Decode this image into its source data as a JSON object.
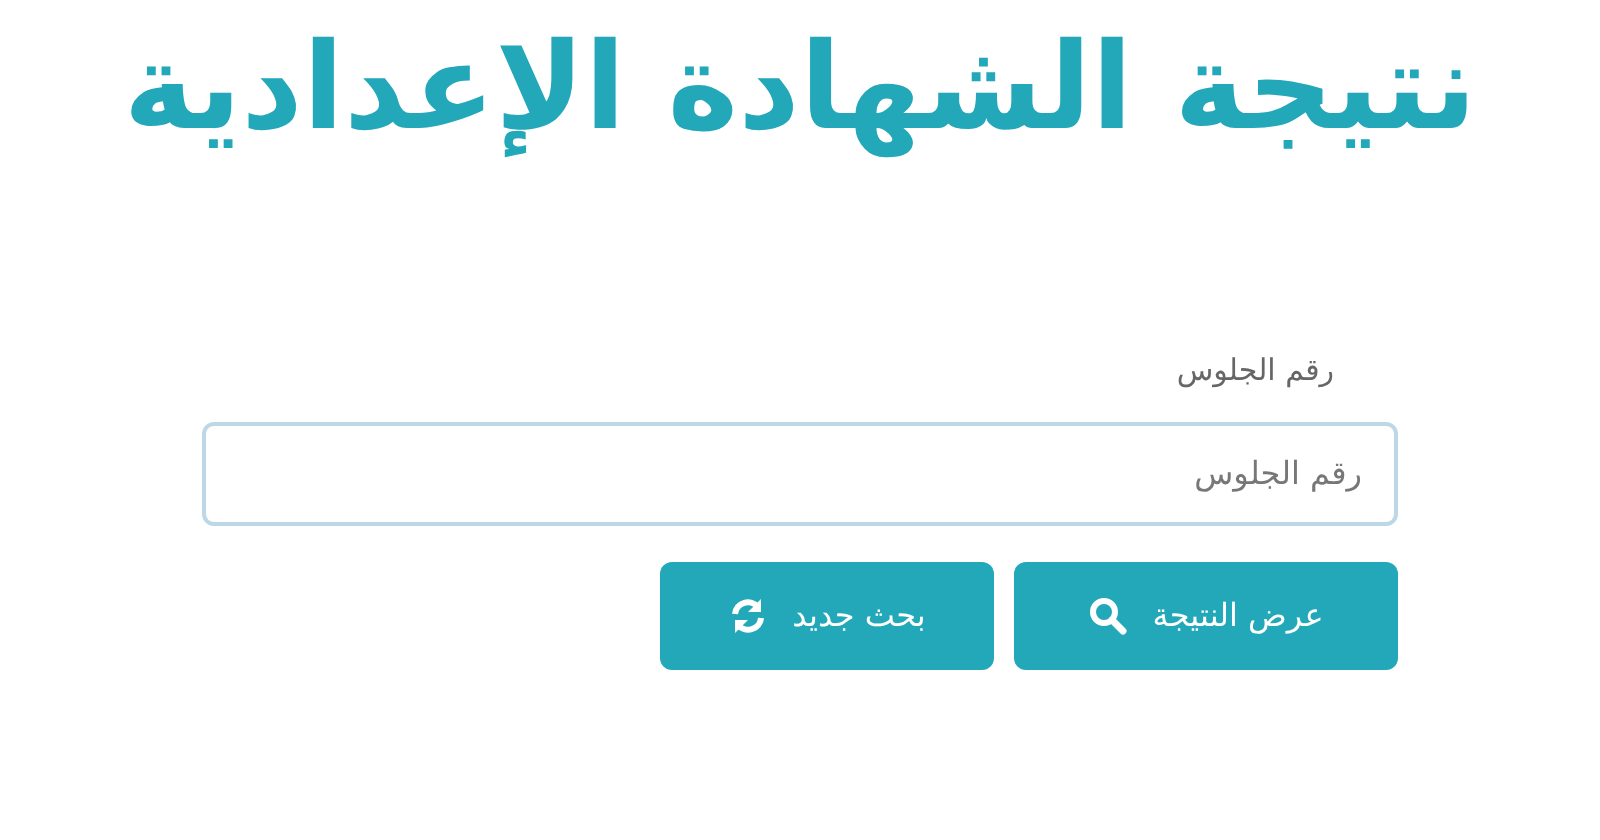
{
  "title": "نتيجة الشهادة الإعدادية",
  "form": {
    "label": "رقم الجلوس",
    "field": {
      "placeholder": "رقم الجلوس"
    },
    "buttons": [
      {
        "kind": "search",
        "label": "عرض النتيجة"
      },
      {
        "kind": "refresh",
        "label": "بحث جديد"
      }
    ]
  }
}
